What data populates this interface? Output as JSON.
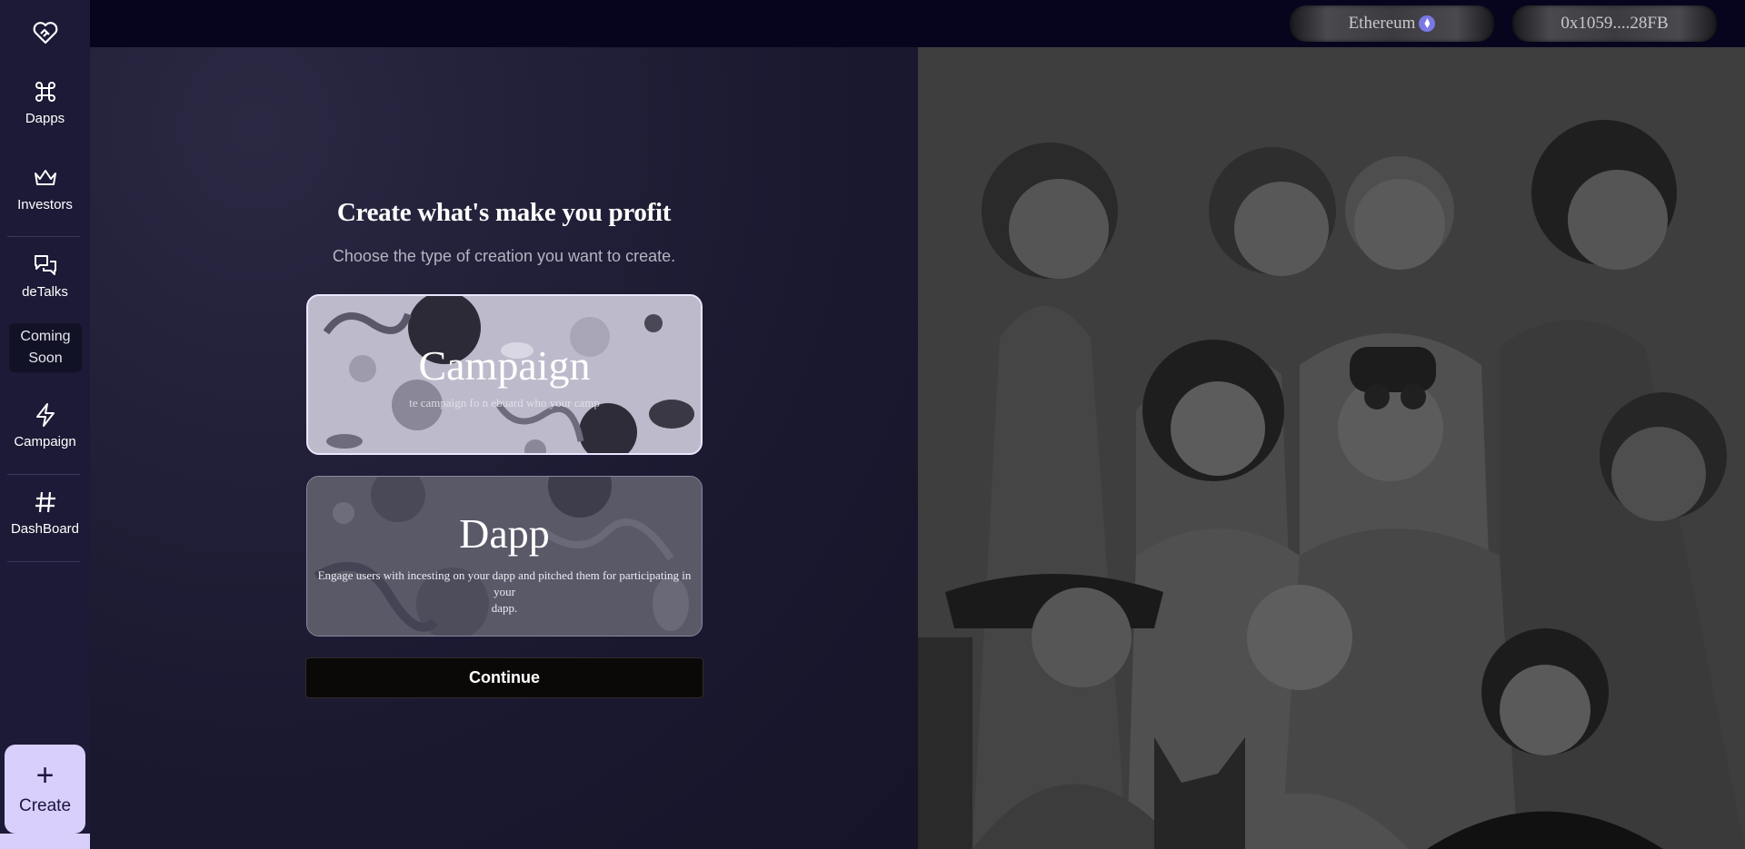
{
  "sidebar": {
    "items": [
      {
        "label": "Dapps",
        "icon": "command-icon"
      },
      {
        "label": "Investors",
        "icon": "crown-icon"
      },
      {
        "label": "deTalks",
        "icon": "chat-icon"
      },
      {
        "label": "Campaign",
        "icon": "lightning-icon"
      },
      {
        "label": "DashBoard",
        "icon": "hash-icon"
      }
    ],
    "coming_soon_line1": "Coming",
    "coming_soon_line2": "Soon",
    "create_label": "Create",
    "create_icon": "plus-icon"
  },
  "topbar": {
    "network_label": "Ethereum",
    "network_icon": "ethereum-icon",
    "wallet_address": "0x1059....28FB"
  },
  "main": {
    "heading": "Create what's make you profit",
    "subheading": "Choose the type of creation you want to create.",
    "cards": [
      {
        "title": "Campaign",
        "description": "te campaign fo          n         ebuard       who             your camp",
        "selected": true
      },
      {
        "title": "Dapp",
        "description_line1": "Engage users with incesting on your dapp and pitched them for participating in your",
        "description_line2": "dapp."
      }
    ],
    "continue_label": "Continue"
  },
  "colors": {
    "sidebar_bg": "#1c1a36",
    "topbar_bg": "#07051e",
    "create_bg": "#d8cffc",
    "card_selected_border": "#eae6ff",
    "illustration_bg": "#3e3e3e"
  }
}
